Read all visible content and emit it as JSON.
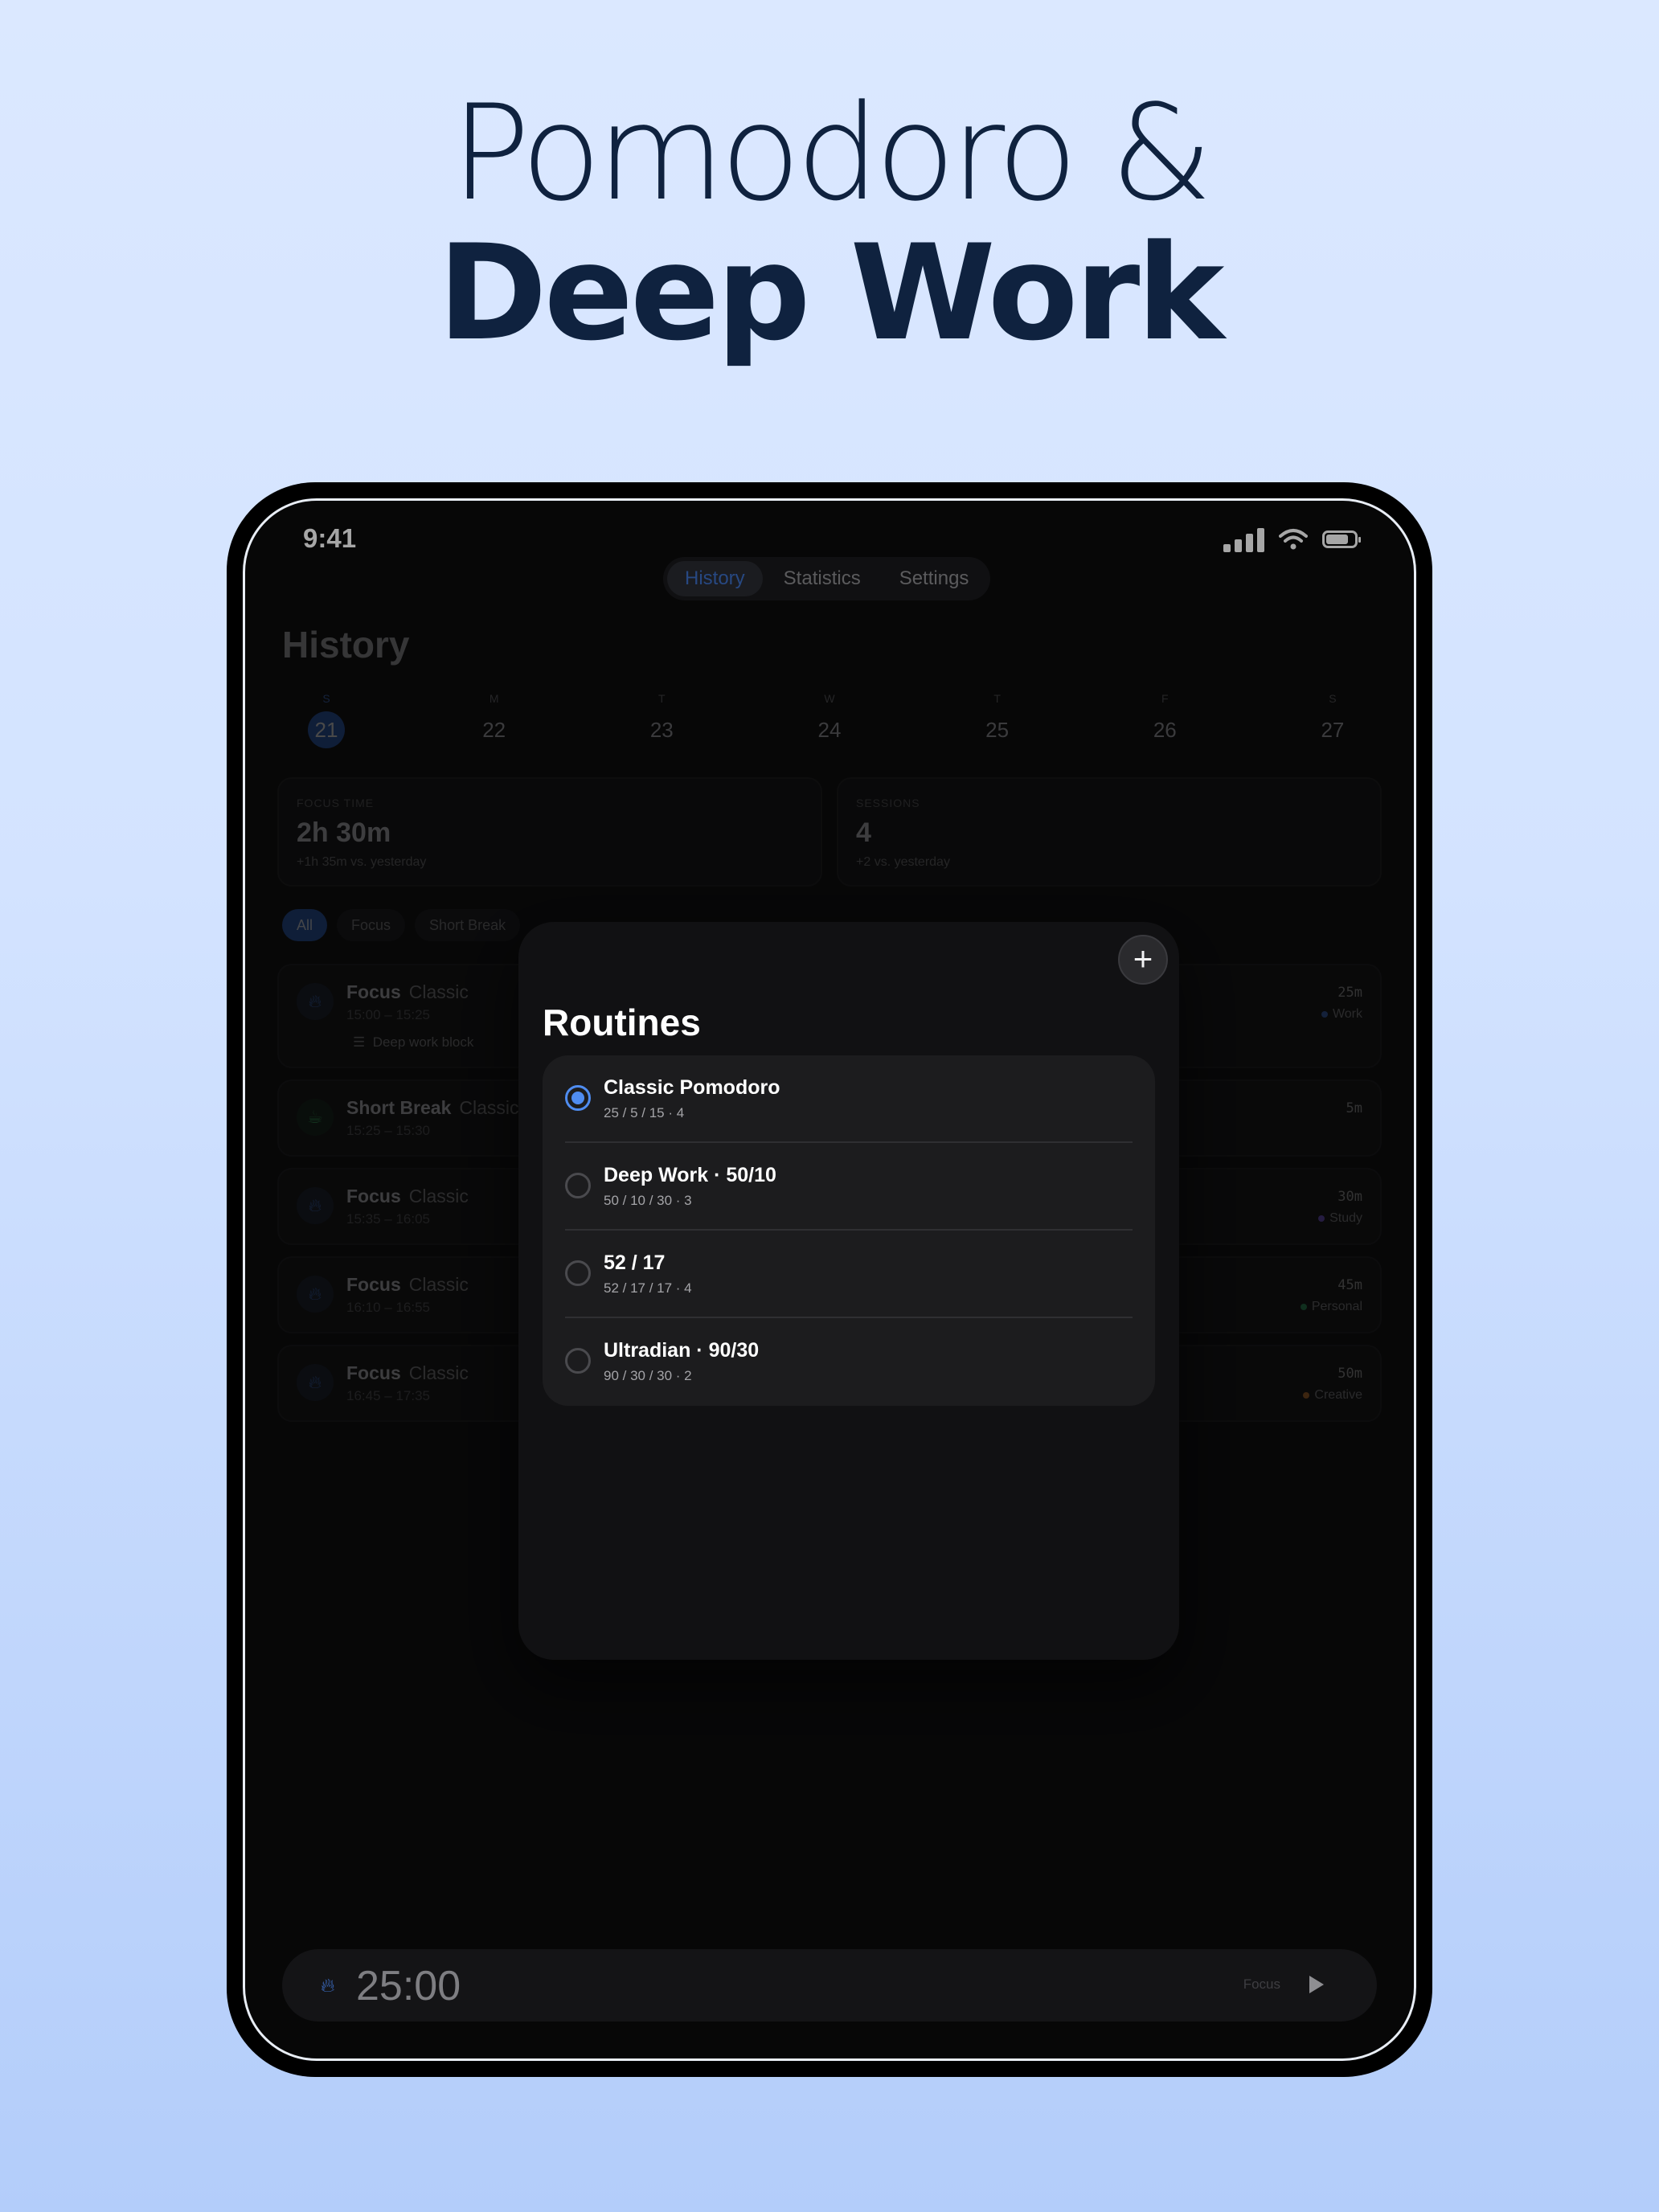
{
  "headline": {
    "line1": "Pomodoro &",
    "line2": "Deep Work"
  },
  "status": {
    "time": "9:41"
  },
  "tabs": [
    {
      "label": "History",
      "active": true
    },
    {
      "label": "Statistics",
      "active": false
    },
    {
      "label": "Settings",
      "active": false
    }
  ],
  "page": {
    "title": "History"
  },
  "week": [
    {
      "dow": "S",
      "num": "21",
      "selected": true
    },
    {
      "dow": "M",
      "num": "22"
    },
    {
      "dow": "T",
      "num": "23"
    },
    {
      "dow": "W",
      "num": "24"
    },
    {
      "dow": "T",
      "num": "25"
    },
    {
      "dow": "F",
      "num": "26"
    },
    {
      "dow": "S",
      "num": "27"
    }
  ],
  "stats": [
    {
      "label": "FOCUS TIME",
      "value": "2h 30m",
      "delta": "+1h 35m vs. yesterday"
    },
    {
      "label": "SESSIONS",
      "value": "4",
      "delta": "+2 vs. yesterday"
    }
  ],
  "filters": [
    {
      "label": "All",
      "active": true
    },
    {
      "label": "Focus"
    },
    {
      "label": "Short Break"
    }
  ],
  "sessions": [
    {
      "title": "Focus",
      "sub": "Classic",
      "time": "15:00 – 15:25",
      "note": "Deep work block",
      "duration": "25m",
      "tag": "Work",
      "tag_color": "#3d6fc8",
      "icon": "flame-icon"
    },
    {
      "title": "Short Break",
      "sub": "Classic",
      "time": "15:25 – 15:30",
      "duration": "5m",
      "icon": "coffee-icon"
    },
    {
      "title": "Focus",
      "sub": "Classic",
      "time": "15:35 – 16:05",
      "duration": "30m",
      "tag": "Study",
      "tag_color": "#7a5ce0",
      "icon": "flame-icon"
    },
    {
      "title": "Focus",
      "sub": "Classic",
      "time": "16:10 – 16:55",
      "duration": "45m",
      "tag": "Personal",
      "tag_color": "#2fa060",
      "icon": "flame-icon"
    },
    {
      "title": "Focus",
      "sub": "Classic",
      "time": "16:45 – 17:35",
      "duration": "50m",
      "tag": "Creative",
      "tag_color": "#d07a2e",
      "icon": "flame-icon"
    }
  ],
  "sheet": {
    "title": "Routines",
    "add_label": "+",
    "routines": [
      {
        "name": "Classic Pomodoro",
        "detail": "25 / 5 / 15 · 4",
        "selected": true
      },
      {
        "name": "Deep Work · 50/10",
        "detail": "50 / 10 / 30 · 3",
        "selected": false
      },
      {
        "name": "52 / 17",
        "detail": "52 / 17 / 17 · 4",
        "selected": false
      },
      {
        "name": "Ultradian · 90/30",
        "detail": "90 / 30 / 30 · 2",
        "selected": false
      }
    ]
  },
  "timer": {
    "time": "25:00",
    "mode": "Focus"
  },
  "colors": {
    "accent": "#2c5fc2",
    "radio": "#4f8cf0",
    "headline": "#0f223f"
  }
}
